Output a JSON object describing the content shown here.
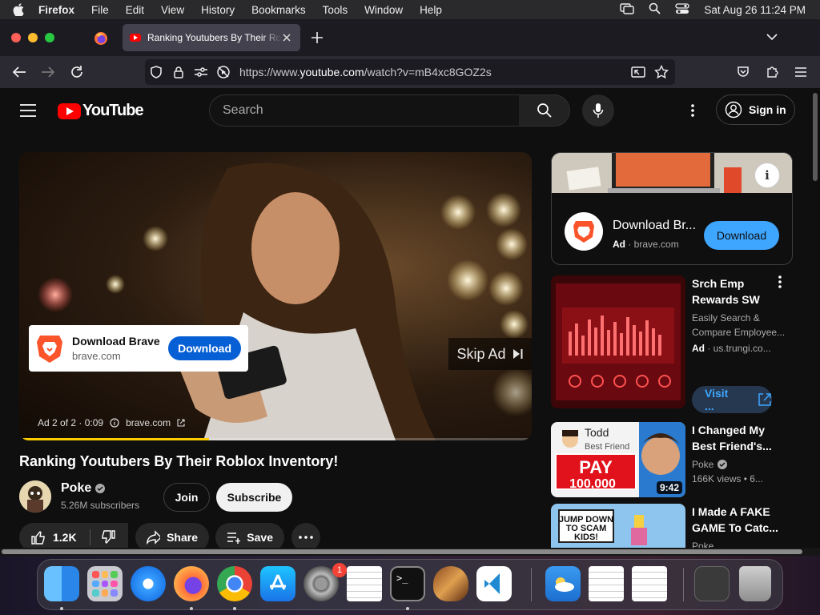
{
  "menubar": {
    "app": "Firefox",
    "items": [
      "File",
      "Edit",
      "View",
      "History",
      "Bookmarks",
      "Tools",
      "Window",
      "Help"
    ],
    "clock": "Sat Aug 26  11:24 PM"
  },
  "browser": {
    "tab_title": "Ranking Youtubers By Their Roblox Inventory!",
    "url_prefix": "https://www.",
    "url_domain": "youtube.com",
    "url_path": "/watch?v=mB4xc8GOZ2s"
  },
  "youtube": {
    "logo_text": "YouTube",
    "search_placeholder": "Search",
    "signin_label": "Sign in",
    "ad_overlay": {
      "title": "Download Brave",
      "domain": "brave.com",
      "button": "Download"
    },
    "skip_label": "Skip Ad",
    "ad_info": "Ad 2 of 2 · 0:09",
    "ad_info_domain": "brave.com",
    "progress": 0.37,
    "video_title": "Ranking Youtubers By Their Roblox Inventory!",
    "channel": {
      "name": "Poke",
      "subscribers": "5.26M subscribers",
      "join": "Join",
      "subscribe": "Subscribe"
    },
    "actions": {
      "likes": "1.2K",
      "share": "Share",
      "save": "Save"
    },
    "side_ad": {
      "title": "Download Br...",
      "ad_label": "Ad",
      "domain": "brave.com",
      "button": "Download"
    },
    "recommendations": [
      {
        "title": "Srch Emp Rewards SW",
        "description": "Easily Search & Compare Employee...",
        "ad_label": "Ad",
        "domain": "us.trungi.co...",
        "button": "Visit ..."
      },
      {
        "title": "I Changed My Best Friend's...",
        "channel": "Poke",
        "meta": "166K views  • 6...",
        "duration": "9:42",
        "thumb_text": [
          "Todd",
          "Best Friend",
          "PAY",
          "100,000"
        ]
      },
      {
        "title": "I Made A FAKE GAME To Catc...",
        "channel": "Poke",
        "thumb_text": [
          "JUMP DOWN",
          "TO SCAM",
          "KIDS!"
        ]
      }
    ]
  },
  "dock": {
    "settings_badge": "1"
  }
}
